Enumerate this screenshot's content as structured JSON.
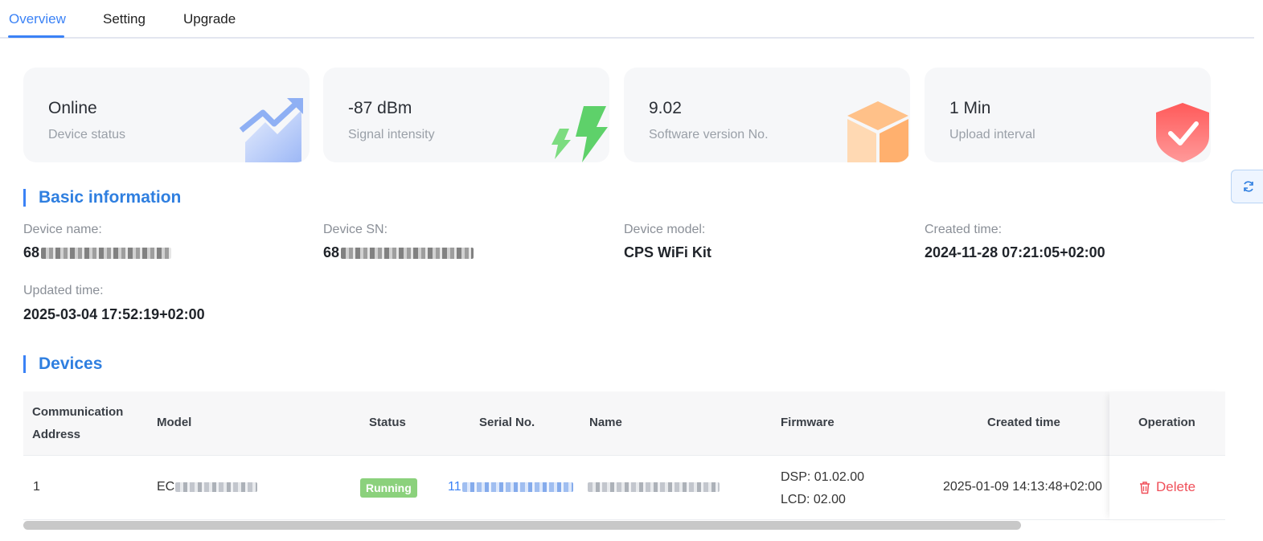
{
  "tabs": [
    {
      "label": "Overview",
      "active": true
    },
    {
      "label": "Setting",
      "active": false
    },
    {
      "label": "Upgrade",
      "active": false
    }
  ],
  "stats": [
    {
      "value": "Online",
      "label": "Device status",
      "icon": "trend-chart-icon"
    },
    {
      "value": "-87 dBm",
      "label": "Signal intensity",
      "icon": "lightning-icon"
    },
    {
      "value": "9.02",
      "label": "Software version No.",
      "icon": "cube-icon"
    },
    {
      "value": "1 Min",
      "label": "Upload interval",
      "icon": "shield-check-icon"
    }
  ],
  "basic_info": {
    "title": "Basic information",
    "device_name_label": "Device name:",
    "device_name_value": "68",
    "device_sn_label": "Device SN:",
    "device_sn_value": "68",
    "device_model_label": "Device model:",
    "device_model_value": "CPS WiFi Kit",
    "created_time_label": "Created time:",
    "created_time_value": "2024-11-28 07:21:05+02:00",
    "updated_time_label": "Updated time:",
    "updated_time_value": "2025-03-04 17:52:19+02:00"
  },
  "devices": {
    "title": "Devices",
    "columns": [
      "Communication Address",
      "Model",
      "Status",
      "Serial No.",
      "Name",
      "Firmware",
      "Created time",
      "Operation"
    ],
    "rows": [
      {
        "address": "1",
        "model": "EC",
        "status": "Running",
        "serial": "11",
        "name": "",
        "firmware_dsp": "DSP: 01.02.00",
        "firmware_lcd": "LCD: 02.00",
        "created_time": "2025-01-09 14:13:48+02:00",
        "operation": "Delete"
      }
    ]
  },
  "colors": {
    "accent": "#3b82f6",
    "running": "#8bd17c",
    "danger": "#f0505a"
  }
}
